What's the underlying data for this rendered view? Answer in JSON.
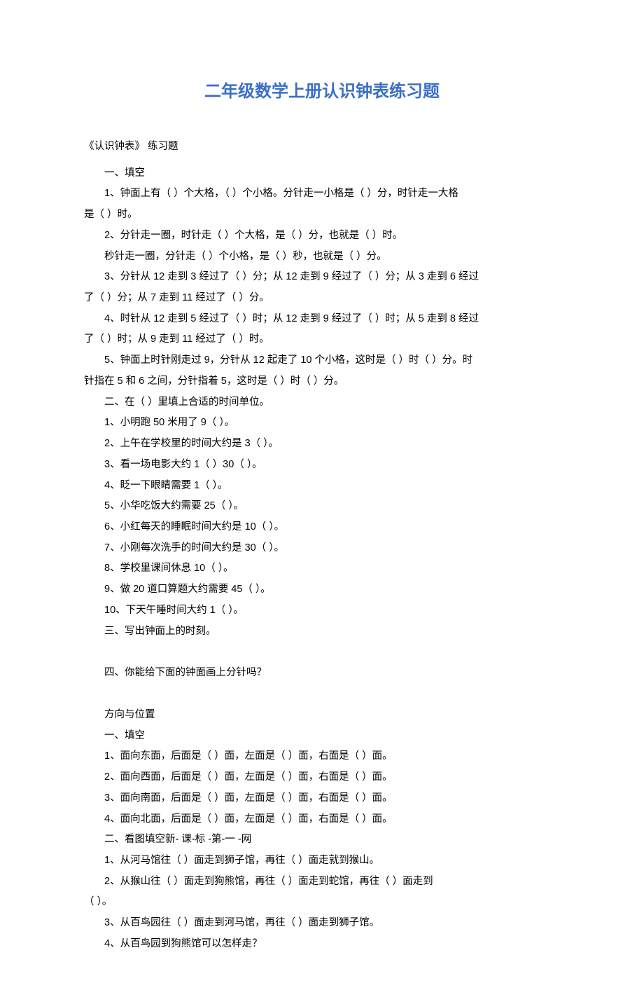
{
  "title": "二年级数学上册认识钟表练习题",
  "subtitle": "《认识钟表》 练习题",
  "sectionA": {
    "header": "一、填空",
    "q1": "1、钟面上有（  ）个大格，（  ）个小格。分针走一小格是（  ）分，时针走一大格",
    "q1b": "是（  ）时。",
    "q2": "2、分针走一圈，时针走（  ）个大格，是（  ）分，也就是（  ）时。",
    "q2b": "秒针走一圈，分针走（  ）个小格，是（  ）秒，也就是（  ）分。",
    "q3": "3、分针从 12 走到 3 经过了（  ）分；从 12 走到 9 经过了（  ）分；从 3 走到 6 经过",
    "q3b": "了（  ）分；从 7 走到 11 经过了（  ）分。",
    "q4": "4、时针从 12 走到 5 经过了（  ）时；从 12 走到 9 经过了（  ）时；从 5 走到 8 经过",
    "q4b": "了（  ）时；从 9 走到 11 经过了（  ）时。",
    "q5": "5、钟面上时针刚走过 9，分针从 12 起走了 10 个小格，这时是（  ）时（  ）分。时",
    "q5b": "针指在 5 和 6 之间，分针指着 5，这时是（  ）时（  ）分。"
  },
  "sectionB": {
    "header": "二、在（  ）里填上合适的时间单位。",
    "items": [
      "1、小明跑 50 米用了 9（  ）。",
      "2、上午在学校里的时间大约是 3（  ）。",
      "3、看一场电影大约 1（  ）30（  ）。",
      "4、眨一下眼睛需要 1（  ）。",
      "5、小华吃饭大约需要 25（  ）。",
      "6、小红每天的睡眠时间大约是 10（  ）。",
      "7、小刚每次洗手的时间大约是 30（  ）。",
      "8、学校里课间休息 10（  ）。",
      "9、做 20 道口算题大约需要 45（  ）。",
      "10、下天午睡时间大约 1（  ）。"
    ]
  },
  "sectionC": "三、写出钟面上的时刻。",
  "sectionD": "四、你能给下面的钟面画上分针吗？",
  "part2": {
    "title": "方向与位置",
    "s1header": "一、填空",
    "s1": [
      "1、面向东面，后面是（  ）面，左面是（  ）面，右面是（  ）面。",
      "2、面向西面，后面是（  ）面，左面是（  ）面，右面是（  ）面。",
      "3、面向南面，后面是（  ）面，左面是（  ）面，右面是（  ）面。",
      "4、面向北面，后面是（  ）面，左面是（  ）面，右面是（  ）面。"
    ],
    "s2header": "二、看图填空新- 课-标 -第-一 -网",
    "s2q1": "1、从河马馆往（  ）面走到狮子馆，再往（  ）面走就到猴山。",
    "s2q2": "2、从猴山往（  ）面走到狗熊馆，再往（  ）面走到蛇馆，再往（  ）面走到",
    "s2q2b": "（  ）。",
    "s2q3": "3、从百鸟园往（  ）面走到河马馆，再往（  ）面走到狮子馆。",
    "s2q4": "4、从百鸟园到狗熊馆可以怎样走？"
  }
}
